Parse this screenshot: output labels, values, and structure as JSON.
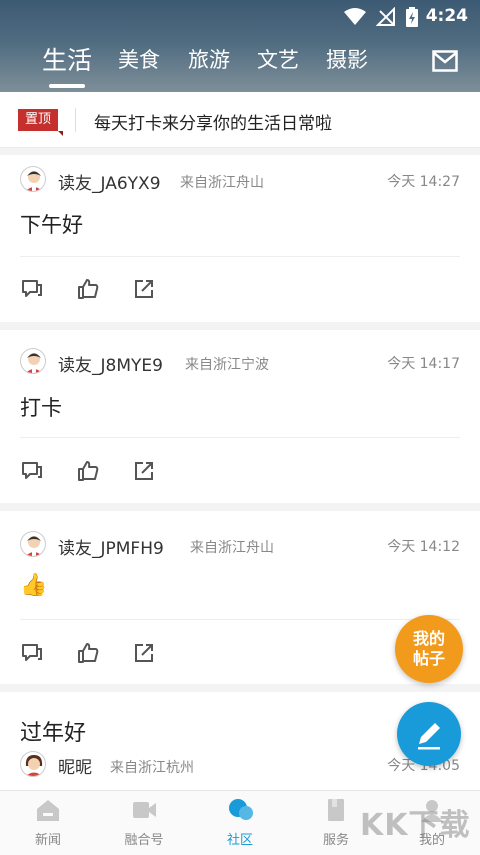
{
  "status_bar": {
    "time": "4:24"
  },
  "tabs": [
    {
      "label": "生活",
      "active": true
    },
    {
      "label": "美食",
      "active": false
    },
    {
      "label": "旅游",
      "active": false
    },
    {
      "label": "文艺",
      "active": false
    },
    {
      "label": "摄影",
      "active": false
    }
  ],
  "pinned": {
    "badge": "置顶",
    "text": "每天打卡来分享你的生活日常啦"
  },
  "posts": [
    {
      "username": "读友_JA6YX9",
      "location": "来自浙江舟山",
      "time": "今天 14:27",
      "content": "下午好"
    },
    {
      "username": "读友_J8MYE9",
      "location": "来自浙江宁波",
      "time": "今天 14:17",
      "content": "打卡"
    },
    {
      "username": "读友_JPMFH9",
      "location": "来自浙江舟山",
      "time": "今天 14:12",
      "content": "👍"
    },
    {
      "username": "昵昵",
      "location": "来自浙江杭州",
      "time": "今天 14:05",
      "content": "过年好"
    }
  ],
  "fab": {
    "mine_line1": "我的",
    "mine_line2": "帖子"
  },
  "bottom_nav": [
    {
      "label": "新闻",
      "active": false
    },
    {
      "label": "融合号",
      "active": false
    },
    {
      "label": "社区",
      "active": true
    },
    {
      "label": "服务",
      "active": false
    },
    {
      "label": "我的",
      "active": false
    }
  ],
  "watermark": "KK下载",
  "colors": {
    "accent": "#199bd9",
    "pin_red": "#c3302d",
    "fab_orange": "#f29a1b"
  }
}
